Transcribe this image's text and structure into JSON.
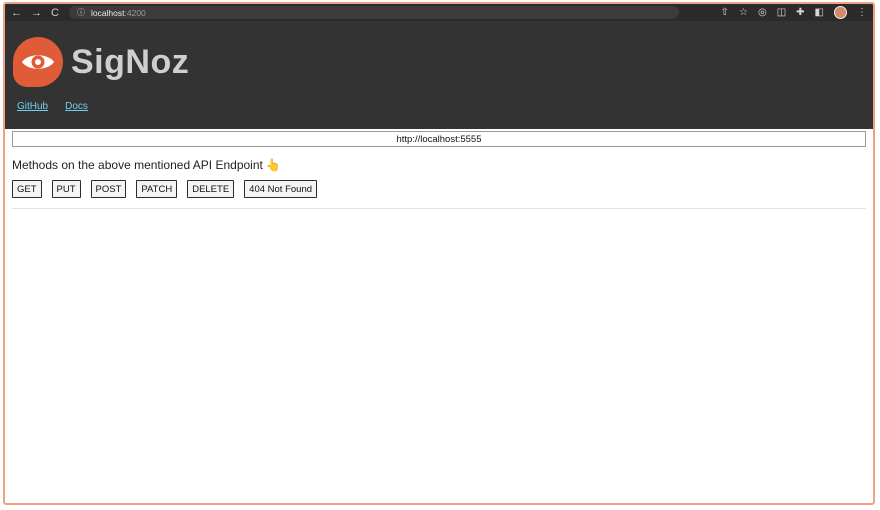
{
  "browser": {
    "back": "←",
    "forward": "→",
    "reload": "C",
    "info": "ⓘ",
    "url_host": "localhost",
    "url_port": ":4200",
    "actions": [
      "⇧",
      "☆",
      "◎",
      "◫",
      "✚",
      "◧",
      "⋮"
    ]
  },
  "header": {
    "logo_text": "SigNoz",
    "links": [
      "GitHub",
      "Docs"
    ]
  },
  "main": {
    "endpoint": "http://localhost:5555",
    "methods_title": "Methods on the above mentioned API Endpoint",
    "methods_emoji": "👆",
    "buttons": [
      "GET",
      "PUT",
      "POST",
      "PATCH",
      "DELETE",
      "404 Not Found"
    ]
  },
  "colors": {
    "header_bg": "#333333",
    "logo_bg": "#e05b37",
    "link": "#6fd0f0",
    "frame_border": "#f0a184"
  }
}
